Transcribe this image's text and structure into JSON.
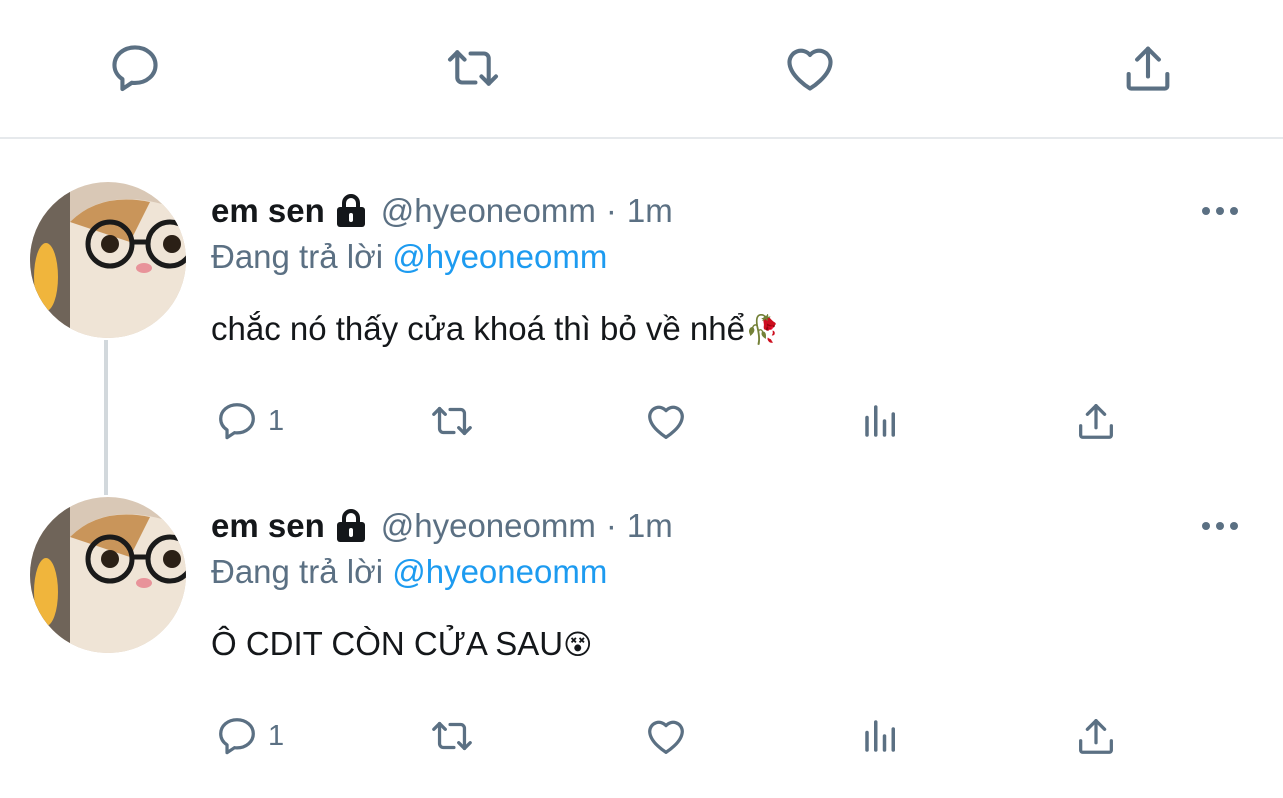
{
  "top_actions": [
    "reply-icon",
    "retweet-icon",
    "like-icon",
    "share-icon"
  ],
  "colors": {
    "accent": "#1d9bf0",
    "secondary_text": "#5b7083",
    "primary_text": "#14171a",
    "icon": "#5b7083",
    "divider": "#e6e9ec"
  },
  "tweets": [
    {
      "name": "em sen",
      "handle": "@hyeoneomm",
      "separator": "·",
      "time": "1m",
      "replying_prefix": "Đang trả lời",
      "replying_to": "@hyeoneomm",
      "text": "chắc nó thấy cửa khoá thì bỏ về nhể",
      "emoji": "🥀",
      "reply_count": "1"
    },
    {
      "name": "em sen",
      "handle": "@hyeoneomm",
      "separator": "·",
      "time": "1m",
      "replying_prefix": "Đang trả lời",
      "replying_to": "@hyeoneomm",
      "text": "Ô CDIT CÒN CỬA SAU",
      "emoji": "😵",
      "reply_count": "1"
    }
  ]
}
